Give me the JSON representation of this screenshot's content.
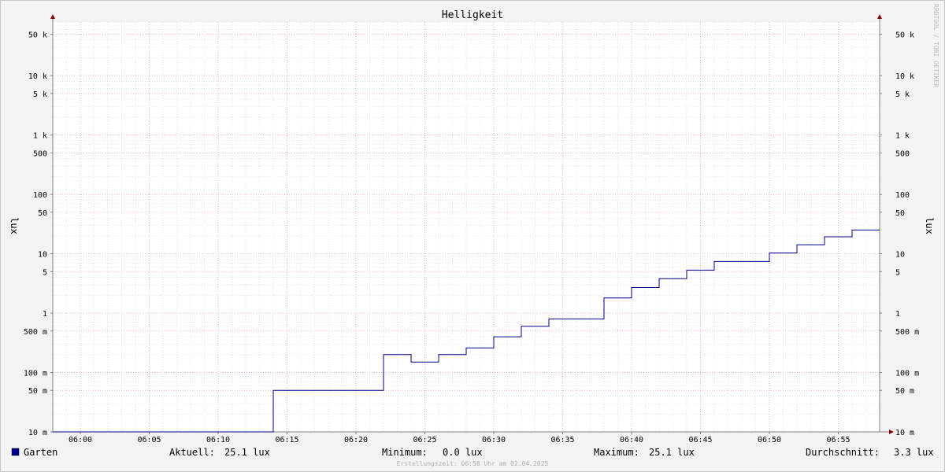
{
  "chart_data": {
    "type": "line",
    "title": "Helligkeit",
    "ylabel": "lux",
    "y_scale": "log",
    "ylim": [
      0.01,
      80000
    ],
    "x": [
      "05:58",
      "06:14",
      "06:14",
      "06:22",
      "06:22",
      "06:24",
      "06:24",
      "06:26",
      "06:26",
      "06:28",
      "06:28",
      "06:30",
      "06:30",
      "06:32",
      "06:32",
      "06:34",
      "06:34",
      "06:38",
      "06:38",
      "06:40",
      "06:40",
      "06:42",
      "06:42",
      "06:44",
      "06:44",
      "06:46",
      "06:46",
      "06:50",
      "06:50",
      "06:52",
      "06:52",
      "06:54",
      "06:54",
      "06:56",
      "06:56",
      "06:58"
    ],
    "y_values": [
      0.01,
      0.01,
      0.05,
      0.05,
      0.2,
      0.2,
      0.15,
      0.15,
      0.2,
      0.2,
      0.26,
      0.26,
      0.4,
      0.4,
      0.6,
      0.6,
      0.8,
      0.8,
      1.8,
      1.8,
      2.7,
      2.7,
      3.8,
      3.8,
      5.3,
      5.3,
      7.4,
      7.4,
      10.3,
      10.3,
      14.2,
      14.2,
      19.3,
      19.3,
      25.1,
      25.1
    ],
    "x_ticks": [
      "06:00",
      "06:05",
      "06:10",
      "06:15",
      "06:20",
      "06:25",
      "06:30",
      "06:35",
      "06:40",
      "06:45",
      "06:50",
      "06:55"
    ],
    "y_ticks": [
      {
        "value": 50000,
        "label": "50 k"
      },
      {
        "value": 10000,
        "label": "10 k"
      },
      {
        "value": 5000,
        "label": "5 k"
      },
      {
        "value": 1000,
        "label": "1 k"
      },
      {
        "value": 500,
        "label": "500"
      },
      {
        "value": 100,
        "label": "100"
      },
      {
        "value": 50,
        "label": "50"
      },
      {
        "value": 10,
        "label": "10"
      },
      {
        "value": 5,
        "label": "5"
      },
      {
        "value": 1,
        "label": "1"
      },
      {
        "value": 0.5,
        "label": "500 m"
      },
      {
        "value": 0.1,
        "label": "100 m"
      },
      {
        "value": 0.05,
        "label": "50 m"
      },
      {
        "value": 0.01,
        "label": "10 m"
      }
    ],
    "grid": true,
    "series": [
      {
        "name": "Garten",
        "color": "#00008b"
      }
    ],
    "legend": {
      "series_name": "Garten",
      "current_label": "Aktuell:",
      "current_value": "25.1 lux",
      "min_label": "Minimum:",
      "min_value": "0.0 lux",
      "max_label": "Maximum:",
      "max_value": "25.1 lux",
      "avg_label": "Durchschnitt:",
      "avg_value": "3.3 lux"
    },
    "footer": "Erstellungszeit: 06:58 Uhr am 02.04.2025",
    "watermark": "RRDTOOL / TOBI OETIKER"
  },
  "colors": {
    "background": "#f3f3f3",
    "plot_background": "#ffffff",
    "major_grid": "#e8a0a0",
    "minor_grid": "#d4d4d4",
    "axis": "#808080",
    "arrow": "#8b0000",
    "line": "#00008b"
  }
}
